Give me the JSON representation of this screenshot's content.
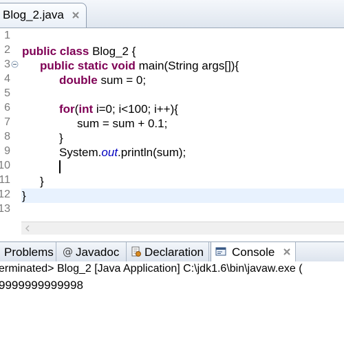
{
  "editor_tab": {
    "title": "Blog_2.java",
    "close_icon": "close-x-icon"
  },
  "editor": {
    "line_numbers": [
      "1",
      "2",
      "3",
      "4",
      "5",
      "6",
      "7",
      "8",
      "9",
      "10",
      "11",
      "12",
      "13"
    ],
    "fold_icon": "collapse-minus-icon",
    "current_line": 10
  },
  "view_tabs": [
    {
      "label": "Problems",
      "icon": "problems-icon",
      "active": false
    },
    {
      "label": "Javadoc",
      "icon": "at-sign-icon",
      "active": false
    },
    {
      "label": "Declaration",
      "icon": "declaration-icon",
      "active": false
    },
    {
      "label": "Console",
      "icon": "console-icon",
      "active": true
    }
  ],
  "console": {
    "header": "erminated> Blog_2 [Java Application] C:\\jdk1.6\\bin\\javaw.exe (",
    "output": "9999999999998"
  }
}
